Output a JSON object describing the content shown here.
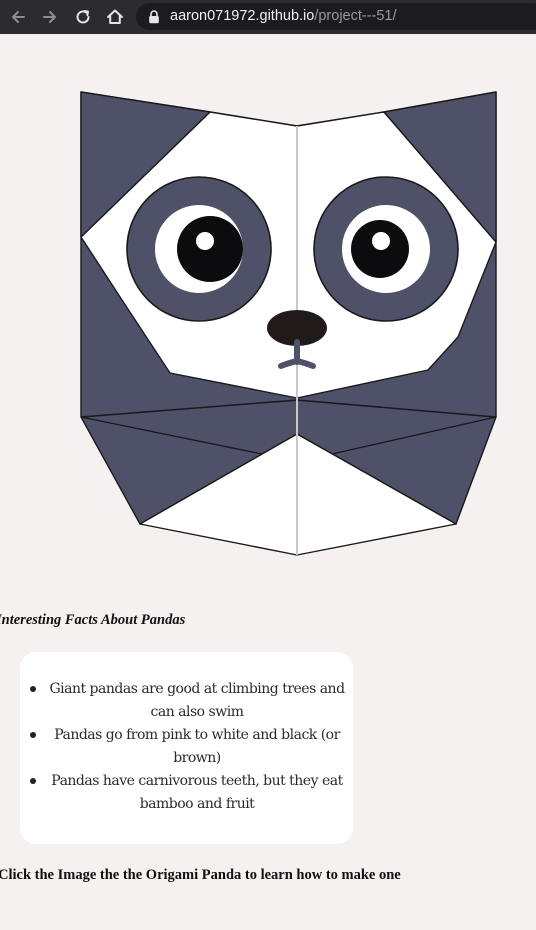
{
  "browser": {
    "url_host": "aaron071972.github.io",
    "url_path": "/project---51/",
    "icons": {
      "back": "arrow-left-icon",
      "forward": "arrow-right-icon",
      "reload": "reload-icon",
      "home": "home-icon",
      "lock": "lock-icon"
    }
  },
  "panda": {
    "colors": {
      "dark": "#4f5169",
      "white": "#ffffff",
      "pupil": "#0c0c0e",
      "nose": "#211a1a",
      "fold_line": "#c8c8c8"
    }
  },
  "facts": {
    "heading": "Interesting Facts About Pandas",
    "items": [
      "Giant pandas are good at climbing trees and can also swim",
      "Pandas go from pink to white and black (or brown)",
      "Pandas have carnivorous teeth, but they eat bamboo and fruit"
    ]
  },
  "cta": "Click the Image the the Origami Panda to learn how to make one"
}
